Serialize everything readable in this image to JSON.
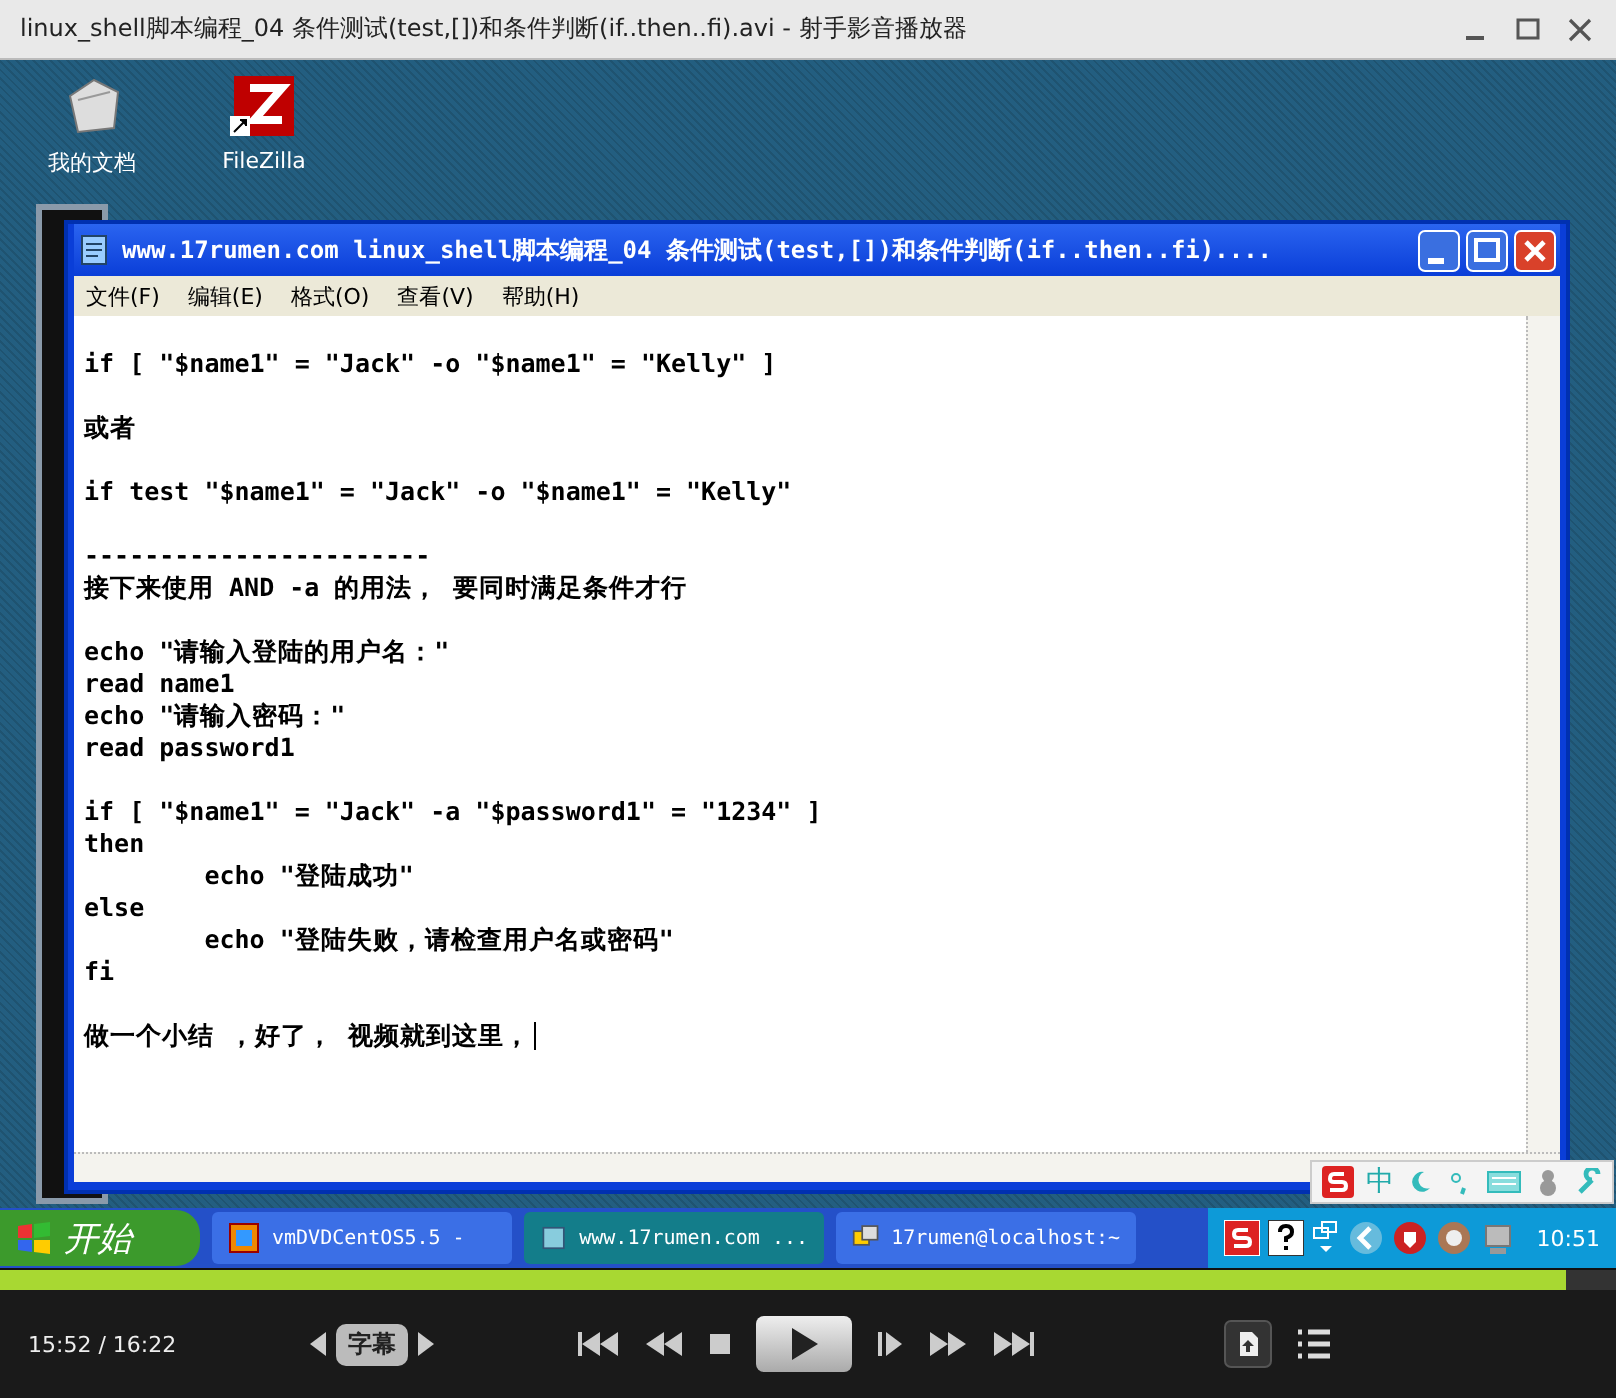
{
  "player": {
    "title": "linux_shell脚本编程_04 条件测试(test,[])和条件判断(if..then..fi).avi - 射手影音播放器"
  },
  "desktop_icons": [
    {
      "label": "我的文档",
      "kind": "documents"
    },
    {
      "label": "FileZilla",
      "kind": "filezilla"
    }
  ],
  "notepad": {
    "title": "www.17rumen.com linux_shell脚本编程_04 条件测试(test,[])和条件判断(if..then..fi)....",
    "menu": [
      "文件(F)",
      "编辑(E)",
      "格式(O)",
      "查看(V)",
      "帮助(H)"
    ],
    "paragraphs": [
      [
        "if [ \"$name1\" = \"Jack\" -o \"$name1\" = \"Kelly\" ]"
      ],
      [
        "或者"
      ],
      [
        "if test \"$name1\" = \"Jack\" -o \"$name1\" = \"Kelly\""
      ],
      [
        "-----------------------",
        "接下来使用 AND -a 的用法， 要同时满足条件才行"
      ],
      [
        "echo \"请输入登陆的用户名：\"",
        "read name1",
        "echo \"请输入密码：\"",
        "read password1"
      ],
      [
        "if [ \"$name1\" = \"Jack\" -a \"$password1\" = \"1234\" ]",
        "then",
        "\techo \"登陆成功\"",
        "else",
        "\techo \"登陆失败，请检查用户名或密码\"",
        "fi"
      ],
      [
        "做一个小结 ，好了， 视频就到这里，"
      ]
    ],
    "caret": true
  },
  "ime_bar": {
    "mode": "中"
  },
  "taskbar": {
    "start": "开始",
    "tasks": [
      {
        "label": "vmDVDCentOS5.5 -",
        "selected": false
      },
      {
        "label": "www.17rumen.com ...",
        "selected": true
      },
      {
        "label": "17rumen@localhost:~",
        "selected": false
      }
    ],
    "clock": "10:51"
  },
  "controls": {
    "time": "15:52 / 16:22",
    "subtitle": "字幕",
    "progress": {
      "level": 0.969
    }
  }
}
